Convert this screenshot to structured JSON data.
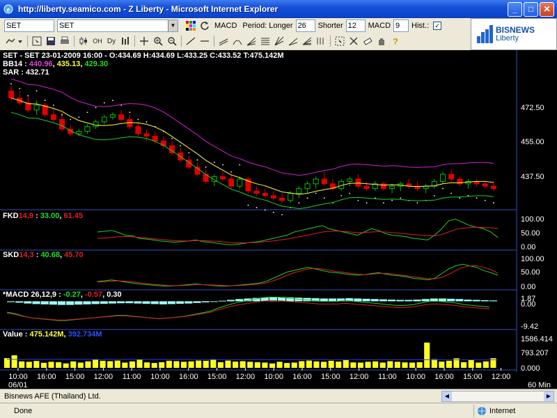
{
  "window": {
    "title": "http://liberty.seamico.com - Z Liberty - Microsoft Internet Explorer",
    "min_label": "_",
    "max_label": "□",
    "close_label": "✕"
  },
  "toolbar": {
    "symbol_value": "SET",
    "symbol_select": "SET",
    "indicator_label": "MACD",
    "period_longer_label": "Period: Longer",
    "period_longer_value": "26",
    "shorter_label": "Shorter",
    "shorter_value": "12",
    "macd_label": "MACD",
    "macd_value": "9",
    "hist_label": "Hist.:",
    "hist_checked": "✓",
    "tools": [
      "line-tool",
      "zoom-in-icon",
      "zoom-out-icon",
      "select-icon",
      "hand-icon",
      "help-icon"
    ]
  },
  "logo": {
    "brand": "BISNEWS",
    "sub": "Liberty"
  },
  "panels": {
    "price": {
      "header": "SET - SET 23-01-2009 16:00 - O:434.69 H:434.69 L:433.25 C:433.52 T:475.142M",
      "bb_label": "BB14 :",
      "bb_upper": "440.96",
      "bb_mid": "435.13",
      "bb_lower": "429.30",
      "sar_label": "SAR : 432.71",
      "yticks": [
        "472.50",
        "455.00",
        "437.50"
      ]
    },
    "fkd": {
      "label": "FKD",
      "param": "14,9",
      "sep": " : ",
      "v1": "33.00",
      "v2": "61.45",
      "yticks": [
        "100.00",
        "50.00",
        "0.00"
      ]
    },
    "skd": {
      "label": "SKD",
      "param": "14,3",
      "sep": " : ",
      "v1": "40.68",
      "v2": "45.70",
      "yticks": [
        "100.00",
        "50.00",
        "0.00"
      ]
    },
    "macd": {
      "label": "*MACD 26,12,9 :",
      "v1": "-0.27",
      "v2": "-0.57",
      "v3": "0.30",
      "yticks": [
        "1.87",
        "0.00",
        "-9.42"
      ]
    },
    "volume": {
      "label": "Value :",
      "v1": "475.142M",
      "v2": "392.734M",
      "yticks": [
        "1586.414",
        "793.207",
        "0.000"
      ]
    }
  },
  "xaxis": {
    "ticks": [
      "10:00",
      "16:00",
      "15:00",
      "12:00",
      "11:00",
      "10:00",
      "16:00",
      "15:00",
      "12:00",
      "10:00",
      "16:00",
      "15:00",
      "12:00",
      "11:00",
      "10:00",
      "16:00",
      "15:00",
      "12:00"
    ],
    "date": "06/01",
    "interval": "60 Min"
  },
  "colors": {
    "up": "#00c000",
    "down": "#e00000",
    "bb_upper": "#d020d0",
    "bb_mid": "#ffff40",
    "bb_lower": "#20d020",
    "sar": "#ffffff",
    "k_line": "#20d020",
    "d_line": "#e02020",
    "macd_hist": "#a0ffff",
    "volume": "#ffff20",
    "vol_avg": "#2040ff"
  },
  "chart_data": [
    {
      "type": "candlestick",
      "series": [
        {
          "name": "SET",
          "values": [
            [
              474,
              476,
              470,
              471
            ],
            [
              471,
              474,
              468,
              469
            ],
            [
              469,
              472,
              465,
              466
            ],
            [
              466,
              470,
              464,
              468
            ],
            [
              468,
              469,
              463,
              464
            ],
            [
              464,
              467,
              461,
              462
            ],
            [
              462,
              465,
              457,
              458
            ],
            [
              458,
              460,
              455,
              456
            ],
            [
              456,
              458,
              455,
              457
            ],
            [
              457,
              460,
              456,
              459
            ],
            [
              459,
              462,
              458,
              461
            ],
            [
              461,
              464,
              460,
              463
            ],
            [
              463,
              465,
              462,
              464
            ],
            [
              464,
              466,
              461,
              462
            ],
            [
              462,
              464,
              458,
              459
            ],
            [
              459,
              461,
              455,
              456
            ],
            [
              456,
              458,
              453,
              455
            ],
            [
              455,
              457,
              452,
              453
            ],
            [
              453,
              455,
              450,
              451
            ],
            [
              451,
              453,
              447,
              448
            ],
            [
              448,
              450,
              444,
              445
            ],
            [
              445,
              447,
              441,
              442
            ],
            [
              442,
              444,
              438,
              439
            ],
            [
              439,
              441,
              435,
              436
            ],
            [
              436,
              439,
              434,
              438
            ],
            [
              438,
              440,
              436,
              437
            ],
            [
              437,
              439,
              433,
              434
            ],
            [
              434,
              438,
              433,
              437
            ],
            [
              437,
              438,
              431,
              432
            ],
            [
              432,
              434,
              430,
              431
            ],
            [
              431,
              433,
              429,
              430
            ],
            [
              430,
              432,
              428,
              429
            ],
            [
              429,
              431,
              427,
              428
            ],
            [
              428,
              432,
              427,
              431
            ],
            [
              431,
              434,
              429,
              433
            ],
            [
              433,
              436,
              431,
              435
            ],
            [
              435,
              438,
              433,
              437
            ],
            [
              437,
              440,
              434,
              435
            ],
            [
              435,
              437,
              432,
              433
            ],
            [
              433,
              437,
              432,
              436
            ],
            [
              436,
              438,
              434,
              437
            ],
            [
              437,
              439,
              433,
              434
            ],
            [
              434,
              436,
              432,
              433
            ],
            [
              433,
              436,
              432,
              435
            ],
            [
              435,
              436,
              432,
              433
            ],
            [
              433,
              435,
              431,
              434
            ],
            [
              434,
              436,
              432,
              435
            ],
            [
              435,
              437,
              433,
              434
            ],
            [
              434,
              436,
              432,
              433
            ],
            [
              433,
              435,
              431,
              434
            ],
            [
              434,
              437,
              433,
              436
            ],
            [
              436,
              440,
              435,
              439
            ],
            [
              439,
              441,
              436,
              437
            ],
            [
              437,
              438,
              434,
              435
            ],
            [
              435,
              437,
              433,
              436
            ],
            [
              436,
              437,
              434,
              435
            ],
            [
              435,
              436,
              433,
              434
            ],
            [
              434,
              436,
              432,
              433
            ]
          ]
        }
      ],
      "ylim": [
        425,
        480
      ]
    },
    {
      "type": "line",
      "series": [
        {
          "name": "FKD",
          "values": [
            50,
            52,
            55,
            48,
            40,
            38,
            30,
            28,
            25,
            22,
            20,
            18,
            20,
            22,
            25,
            20,
            18,
            15,
            12,
            10,
            12,
            15,
            18,
            20,
            25,
            30,
            35,
            40,
            50,
            55,
            60,
            65,
            70,
            60,
            55,
            50,
            45,
            40,
            50,
            60,
            55,
            45,
            40,
            38,
            35,
            30,
            28,
            25,
            40,
            60,
            85,
            90,
            80,
            70,
            65,
            60,
            50,
            33
          ]
        },
        {
          "name": "FKD-D",
          "values": [
            30,
            31,
            33,
            35,
            36,
            35,
            33,
            31,
            29,
            27,
            25,
            23,
            22,
            22,
            23,
            23,
            22,
            21,
            19,
            17,
            16,
            16,
            17,
            18,
            20,
            22,
            25,
            28,
            32,
            36,
            40,
            45,
            50,
            52,
            53,
            52,
            50,
            48,
            48,
            50,
            51,
            50,
            48,
            46,
            44,
            42,
            40,
            38,
            38,
            42,
            50,
            58,
            62,
            64,
            65,
            64,
            63,
            61
          ]
        }
      ],
      "ylim": [
        0,
        100
      ]
    },
    {
      "type": "line",
      "series": [
        {
          "name": "SKD",
          "values": [
            20,
            22,
            25,
            22,
            18,
            15,
            12,
            10,
            8,
            6,
            5,
            6,
            8,
            10,
            12,
            10,
            8,
            6,
            5,
            6,
            8,
            10,
            12,
            15,
            20,
            30,
            40,
            50,
            55,
            60,
            65,
            60,
            55,
            50,
            48,
            45,
            42,
            40,
            42,
            45,
            48,
            44,
            40,
            38,
            35,
            30,
            28,
            25,
            30,
            45,
            60,
            70,
            75,
            70,
            65,
            55,
            48,
            40
          ]
        },
        {
          "name": "SKD-D",
          "values": [
            18,
            19,
            21,
            22,
            21,
            19,
            16,
            13,
            11,
            9,
            7,
            6,
            7,
            8,
            10,
            10,
            9,
            8,
            7,
            6,
            7,
            8,
            10,
            12,
            15,
            22,
            30,
            40,
            48,
            54,
            60,
            62,
            60,
            56,
            52,
            49,
            46,
            43,
            42,
            43,
            45,
            46,
            44,
            41,
            38,
            35,
            32,
            29,
            28,
            33,
            42,
            55,
            65,
            70,
            70,
            65,
            58,
            46
          ]
        }
      ],
      "ylim": [
        0,
        100
      ]
    },
    {
      "type": "bar",
      "series": [
        {
          "name": "MACD Hist",
          "values": [
            -0.3,
            -0.5,
            -0.8,
            -1.0,
            -1.1,
            -1.2,
            -1.3,
            -1.3,
            -1.2,
            -1.1,
            -1.0,
            -0.9,
            -0.8,
            -0.7,
            -0.7,
            -0.8,
            -0.9,
            -1.0,
            -1.1,
            -1.0,
            -0.9,
            -0.8,
            -0.6,
            -0.4,
            -0.2,
            0.2,
            0.5,
            0.8,
            1.0,
            1.2,
            1.4,
            1.5,
            1.5,
            1.4,
            1.3,
            1.2,
            1.1,
            1.0,
            1.0,
            1.0,
            1.1,
            1.0,
            0.9,
            0.8,
            0.7,
            0.6,
            0.5,
            0.5,
            0.6,
            0.8,
            1.0,
            1.0,
            0.9,
            0.8,
            0.6,
            0.5,
            0.4,
            0.3
          ]
        }
      ],
      "ylim": [
        -9.42,
        1.87
      ]
    },
    {
      "type": "bar",
      "series": [
        {
          "name": "Value",
          "values": [
            480,
            620,
            320,
            300,
            340,
            250,
            300,
            280,
            220,
            320,
            260,
            320,
            400,
            350,
            330,
            360,
            260,
            320,
            400,
            270,
            240,
            280,
            350,
            330,
            300,
            320,
            360,
            350,
            400,
            280,
            360,
            310,
            330,
            300,
            280,
            260,
            220,
            300,
            240,
            260,
            330,
            360,
            320,
            300,
            350,
            310,
            380,
            270,
            260,
            300,
            320,
            260,
            330,
            300,
            270,
            260,
            280,
            1250,
            430,
            310,
            350,
            470,
            280,
            380,
            260,
            320,
            475
          ]
        }
      ],
      "ylim": [
        0,
        1586.414
      ]
    }
  ]
}
